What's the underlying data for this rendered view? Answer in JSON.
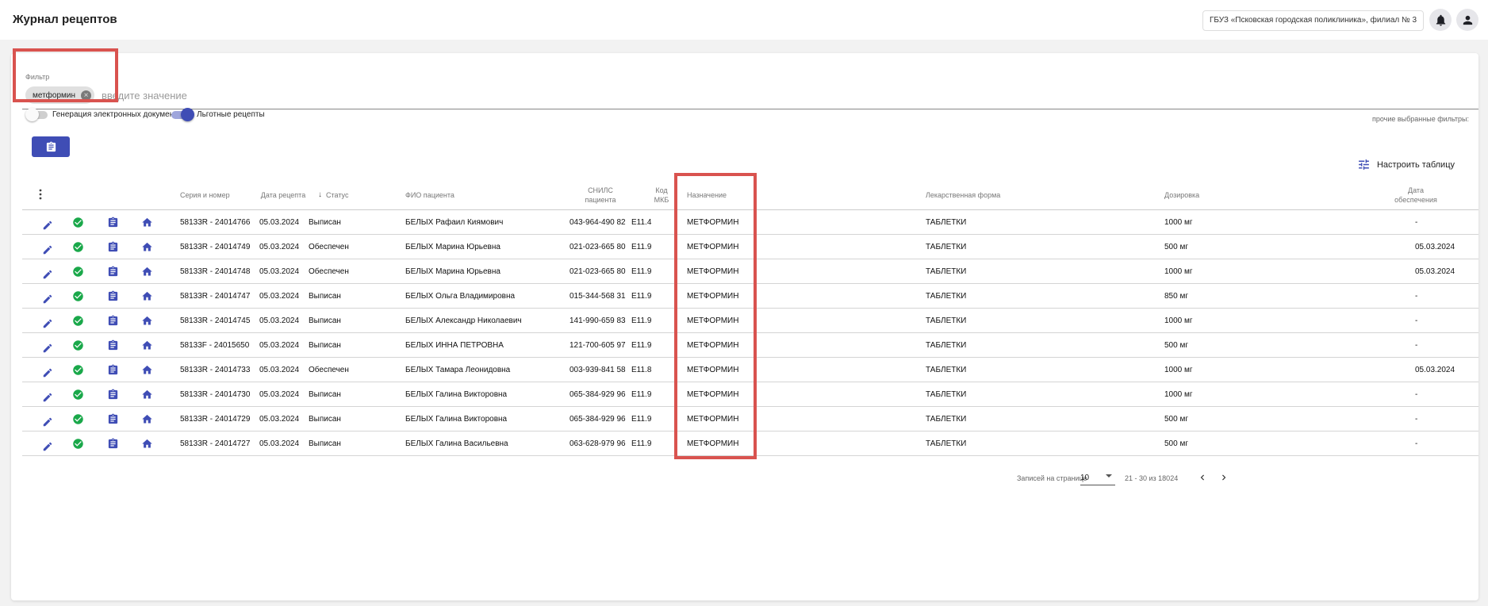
{
  "header": {
    "title": "Журнал рецептов",
    "organization": "ГБУЗ «Псковская городская поликлиника», филиал № 3"
  },
  "filter": {
    "label": "Фильтр",
    "chip": "метформин",
    "placeholder": "введите значение",
    "other_filters": "прочие выбранные фильтры:"
  },
  "toggles": {
    "edocs_label": "Генерация электронных документов",
    "edocs_on": false,
    "privileged_label": "Льготные рецепты",
    "privileged_on": true
  },
  "table_settings_label": "Настроить таблицу",
  "table": {
    "columns": {
      "series": "Серия и номер",
      "date": "Дата рецепта",
      "status": "Статус",
      "patient": "ФИО пациента",
      "snils": "СНИЛС пациента",
      "mkb": "Код МКБ",
      "drug": "Назначение",
      "form": "Лекарственная форма",
      "dose": "Дозировка",
      "supply_date": "Дата обеспечения"
    },
    "rows": [
      {
        "series": "58133R - 24014766",
        "date": "05.03.2024",
        "status": "Выписан",
        "patient": "БЕЛЫХ Рафаил Киямович",
        "snils": "043-964-490 82",
        "mkb": "E11.4",
        "drug": "МЕТФОРМИН",
        "form": "ТАБЛЕТКИ",
        "dose": "1000 мг",
        "supply_date": "-"
      },
      {
        "series": "58133R - 24014749",
        "date": "05.03.2024",
        "status": "Обеспечен",
        "patient": "БЕЛЫХ Марина Юрьевна",
        "snils": "021-023-665 80",
        "mkb": "E11.9",
        "drug": "МЕТФОРМИН",
        "form": "ТАБЛЕТКИ",
        "dose": "500 мг",
        "supply_date": "05.03.2024"
      },
      {
        "series": "58133R - 24014748",
        "date": "05.03.2024",
        "status": "Обеспечен",
        "patient": "БЕЛЫХ Марина Юрьевна",
        "snils": "021-023-665 80",
        "mkb": "E11.9",
        "drug": "МЕТФОРМИН",
        "form": "ТАБЛЕТКИ",
        "dose": "1000 мг",
        "supply_date": "05.03.2024"
      },
      {
        "series": "58133R - 24014747",
        "date": "05.03.2024",
        "status": "Выписан",
        "patient": "БЕЛЫХ Ольга Владимировна",
        "snils": "015-344-568 31",
        "mkb": "E11.9",
        "drug": "МЕТФОРМИН",
        "form": "ТАБЛЕТКИ",
        "dose": "850 мг",
        "supply_date": "-"
      },
      {
        "series": "58133R - 24014745",
        "date": "05.03.2024",
        "status": "Выписан",
        "patient": "БЕЛЫХ Александр Николаевич",
        "snils": "141-990-659 83",
        "mkb": "E11.9",
        "drug": "МЕТФОРМИН",
        "form": "ТАБЛЕТКИ",
        "dose": "1000 мг",
        "supply_date": "-"
      },
      {
        "series": "58133F - 24015650",
        "date": "05.03.2024",
        "status": "Выписан",
        "patient": "БЕЛЫХ ИННА ПЕТРОВНА",
        "snils": "121-700-605 97",
        "mkb": "E11.9",
        "drug": "МЕТФОРМИН",
        "form": "ТАБЛЕТКИ",
        "dose": "500 мг",
        "supply_date": "-"
      },
      {
        "series": "58133R - 24014733",
        "date": "05.03.2024",
        "status": "Обеспечен",
        "patient": "БЕЛЫХ Тамара Леонидовна",
        "snils": "003-939-841 58",
        "mkb": "E11.8",
        "drug": "МЕТФОРМИН",
        "form": "ТАБЛЕТКИ",
        "dose": "1000 мг",
        "supply_date": "05.03.2024"
      },
      {
        "series": "58133R - 24014730",
        "date": "05.03.2024",
        "status": "Выписан",
        "patient": "БЕЛЫХ Галина Викторовна",
        "snils": "065-384-929 96",
        "mkb": "E11.9",
        "drug": "МЕТФОРМИН",
        "form": "ТАБЛЕТКИ",
        "dose": "1000 мг",
        "supply_date": "-"
      },
      {
        "series": "58133R - 24014729",
        "date": "05.03.2024",
        "status": "Выписан",
        "patient": "БЕЛЫХ Галина Викторовна",
        "snils": "065-384-929 96",
        "mkb": "E11.9",
        "drug": "МЕТФОРМИН",
        "form": "ТАБЛЕТКИ",
        "dose": "500 мг",
        "supply_date": "-"
      },
      {
        "series": "58133R - 24014727",
        "date": "05.03.2024",
        "status": "Выписан",
        "patient": "БЕЛЫХ Галина Васильевна",
        "snils": "063-628-979 96",
        "mkb": "E11.9",
        "drug": "МЕТФОРМИН",
        "form": "ТАБЛЕТКИ",
        "dose": "500 мг",
        "supply_date": "-"
      }
    ]
  },
  "pagination": {
    "per_page_label": "Записей на странице",
    "per_page": "10",
    "range": "21 - 30 из 18024"
  },
  "icons": {
    "notifications": "bell-icon",
    "profile": "person-icon",
    "clipboard": "clipboard-icon",
    "settings": "tune-icon",
    "column_menu": "more-vert-icon",
    "row_actions": [
      "edit-pencil-icon",
      "check-circle-icon",
      "clipboard-icon",
      "home-icon"
    ],
    "sort": "arrow-down-icon"
  },
  "colors": {
    "accent": "#3f4db5",
    "success": "#1aa84a",
    "highlight": "#d9534f"
  }
}
